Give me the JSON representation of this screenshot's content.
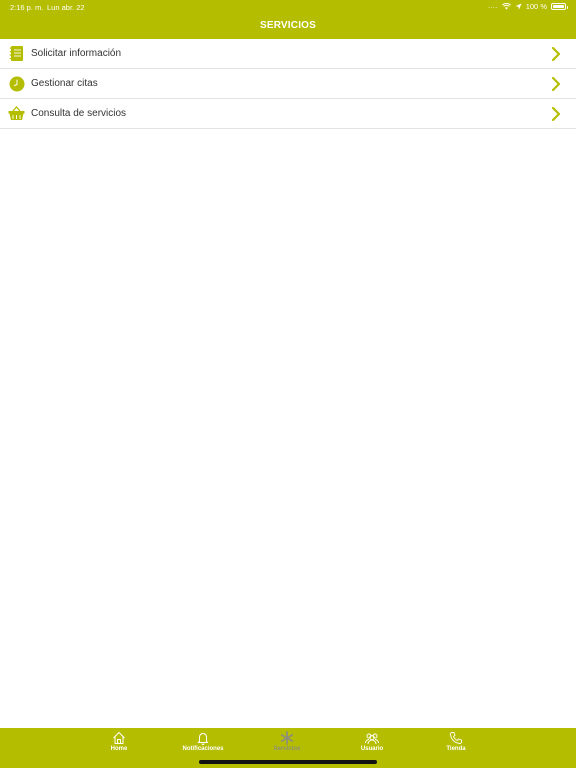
{
  "status_bar": {
    "time": "2:16 p. m.",
    "date": "Lun abr. 22",
    "signal_dots": "....",
    "battery": "100 %"
  },
  "header": {
    "title": "SERVICIOS"
  },
  "menu": {
    "items": [
      {
        "label": "Solicitar información",
        "icon": "notepad-icon"
      },
      {
        "label": "Gestionar citas",
        "icon": "clock-icon"
      },
      {
        "label": "Consulta de servicios",
        "icon": "basket-icon"
      }
    ]
  },
  "tabbar": {
    "tabs": [
      {
        "label": "Home",
        "icon": "home-icon",
        "active": false
      },
      {
        "label": "Notificaciones",
        "icon": "bell-icon",
        "active": false
      },
      {
        "label": "Servicios",
        "icon": "asterisk-icon",
        "active": true
      },
      {
        "label": "Usuario",
        "icon": "users-icon",
        "active": false
      },
      {
        "label": "Tienda",
        "icon": "phone-icon",
        "active": false
      }
    ]
  },
  "colors": {
    "brand": "#b5bd00",
    "text": "#333333",
    "inactive_tab": "#8e8f7a"
  }
}
